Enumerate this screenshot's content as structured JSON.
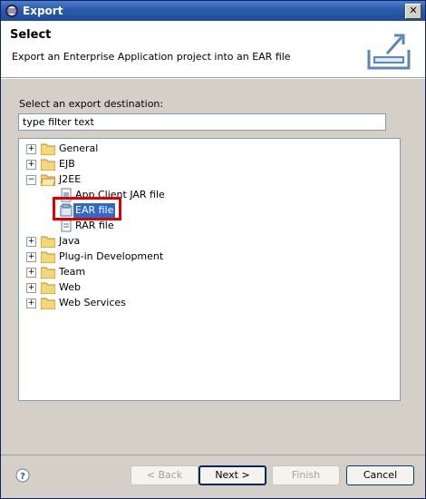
{
  "window": {
    "title": "Export",
    "close_label": "✕"
  },
  "header": {
    "heading": "Select",
    "description": "Export an Enterprise Application project into an EAR file"
  },
  "destination_label": "Select an export destination:",
  "filter": {
    "value": "type filter text"
  },
  "tree": {
    "items": [
      {
        "label": "General",
        "expander": "+"
      },
      {
        "label": "EJB",
        "expander": "+"
      },
      {
        "label": "J2EE",
        "expander": "−"
      },
      {
        "label": "App Client JAR file"
      },
      {
        "label": "EAR file"
      },
      {
        "label": "RAR file"
      },
      {
        "label": "Java",
        "expander": "+"
      },
      {
        "label": "Plug-in Development",
        "expander": "+"
      },
      {
        "label": "Team",
        "expander": "+"
      },
      {
        "label": "Web",
        "expander": "+"
      },
      {
        "label": "Web Services",
        "expander": "+"
      }
    ]
  },
  "buttons": {
    "back": "< Back",
    "next": "Next >",
    "finish": "Finish",
    "cancel": "Cancel"
  },
  "colors": {
    "selection": "#316ac5",
    "highlight_box": "#e00000"
  }
}
